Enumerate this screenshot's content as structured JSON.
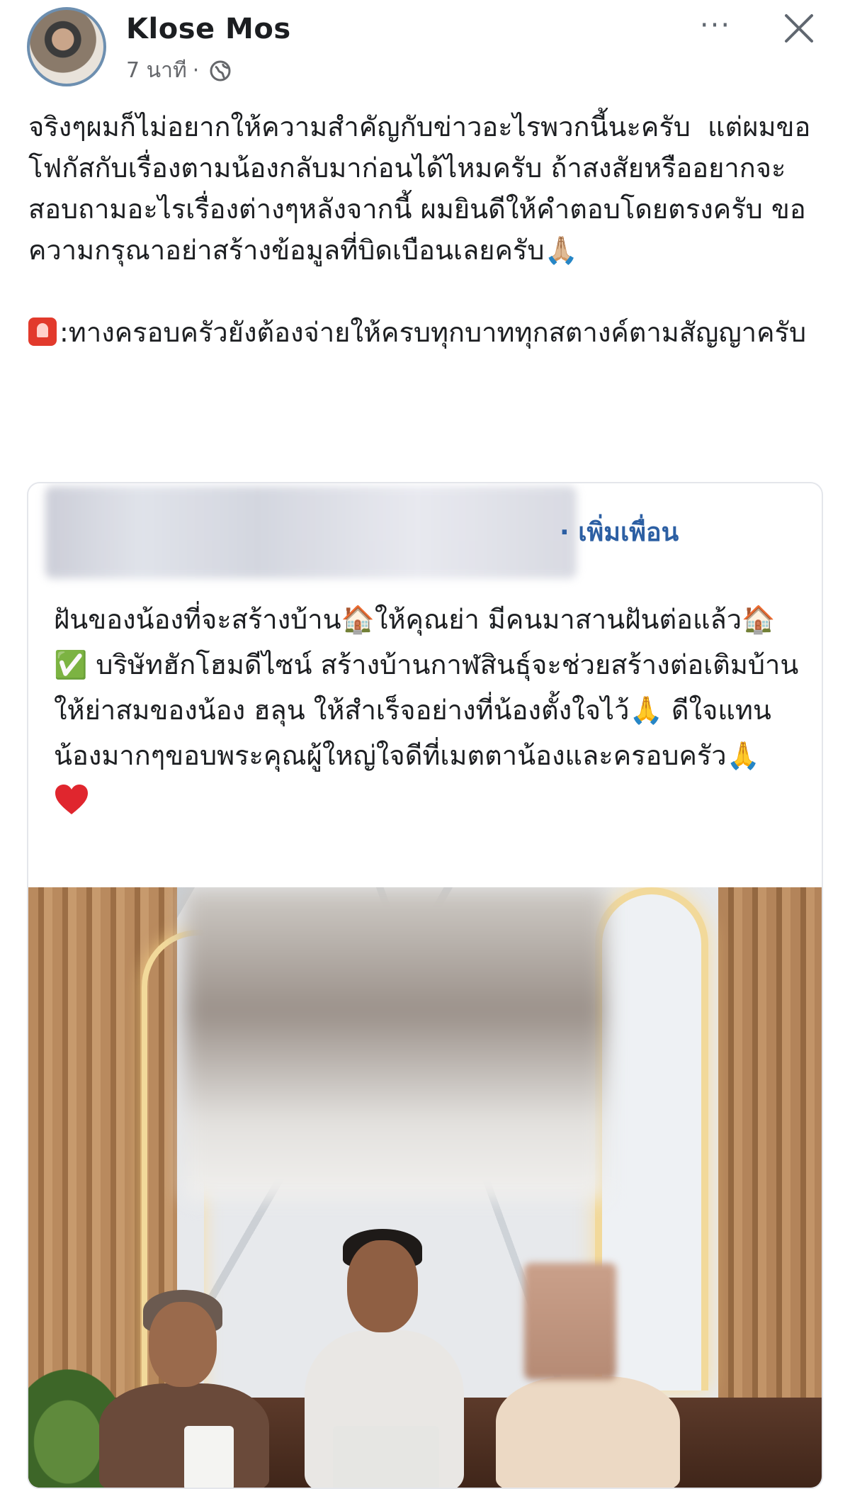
{
  "post": {
    "author": "Klose Mos",
    "time": "7 นาที",
    "separator": "·",
    "more": "···",
    "paragraph1": "จริงๆผมก็ไม่อยากให้ความสำคัญกับข่าวอะไรพวกนี้นะครับ  แต่ผมขอโฟกัสกับเรื่องตามน้องกลับมาก่อนได้ไหมครับ ถ้าสงสัยหรืออยากจะสอบถามอะไรเรื่องต่างๆหลังจากนี้ ผมยินดีให้คำตอบโดยตรงครับ ขอความกรุณาอย่าสร้างข้อมูลที่บิดเบือนเลยครับ🙏🏼",
    "paragraph2": ":ทางครอบครัวยังต้องจ่ายให้ครบทุกบาททุกสตางค์ตามสัญญาครับ"
  },
  "shared": {
    "add_friend": "· เพิ่มเพื่อน",
    "text": "ฝันของน้องที่จะสร้างบ้าน🏠ให้คุณย่า มีคนมาสานฝันต่อแล้ว🏠✅ บริษัทฮักโฮมดีไซน์ สร้างบ้านกาฬสินธุ์จะช่วยสร้างต่อเติมบ้านให้ย่าสมของน้อง ฮลุน ให้สำเร็จอย่างที่น้องตั้งใจไว้🙏 ดีใจแทนน้องมากๆขอบพระคุณผู้ใหญ่ใจดีที่เมตตาน้องและครอบครัว🙏"
  },
  "icons": {
    "avatar": "profile-photo",
    "globe": "globe-icon",
    "more": "more-options-icon",
    "close": "close-icon",
    "siren": "siren-icon",
    "heart": "red-heart-icon"
  },
  "colors": {
    "link": "#2c5fa3",
    "meta": "#65676b",
    "heart": "#e0262e"
  }
}
